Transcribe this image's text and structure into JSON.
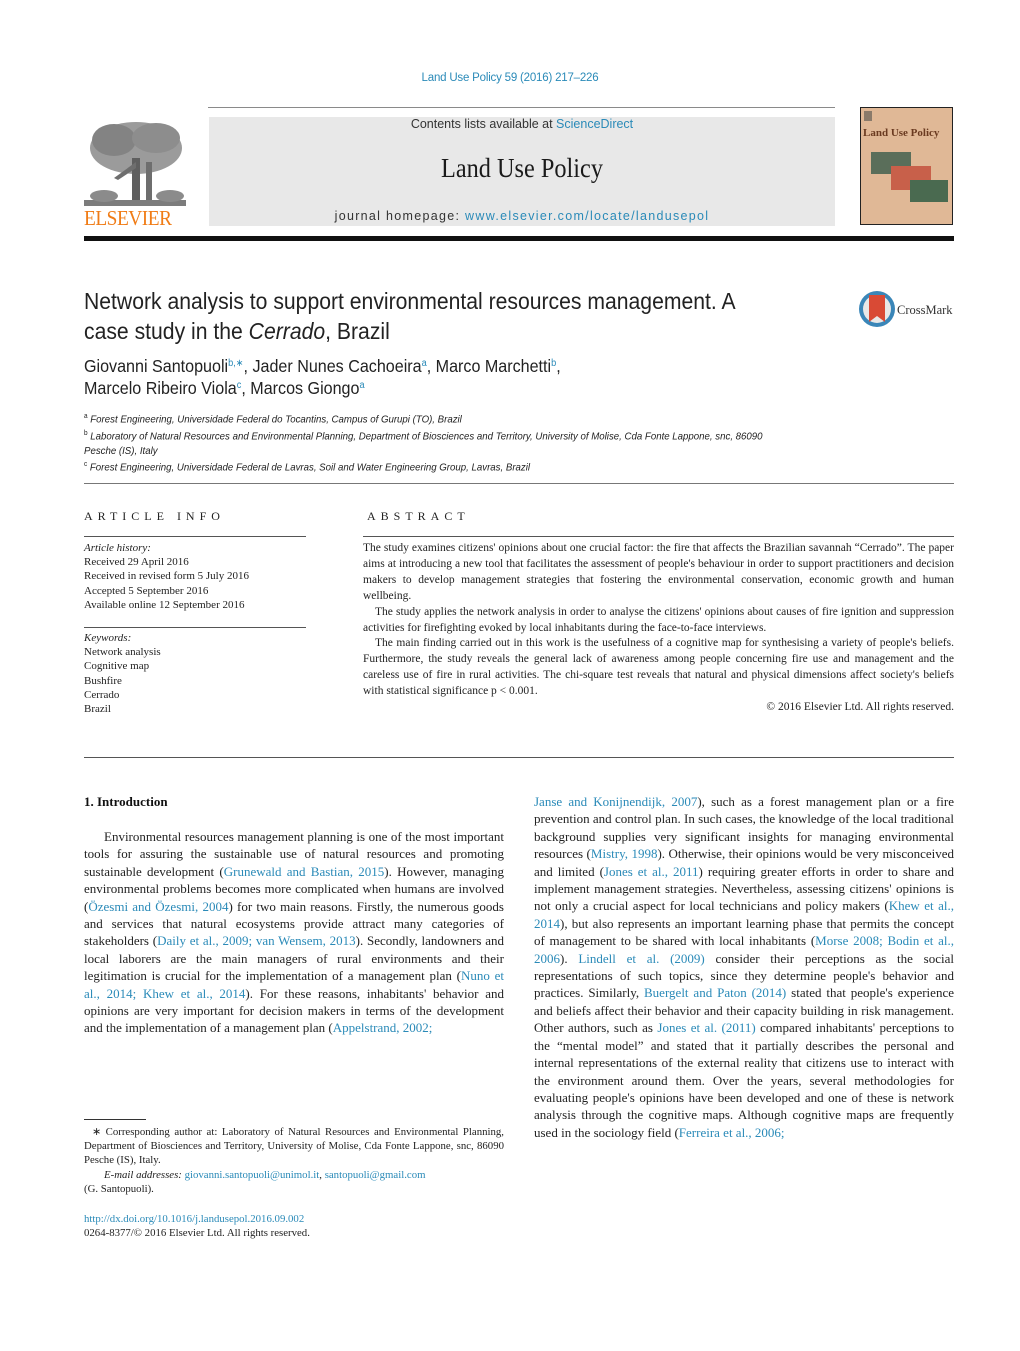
{
  "header": {
    "citation": "Land Use Policy 59 (2016) 217–226",
    "contents_prefix": "Contents lists available at ",
    "contents_link": "ScienceDirect",
    "journal_title": "Land Use Policy",
    "homepage_prefix": "journal homepage: ",
    "homepage_link": "www.elsevier.com/locate/landusepol",
    "publisher_logo_text": "ELSEVIER",
    "cover_title": "Land Use Policy",
    "colors": {
      "link": "#2a8ab8",
      "elsevier_orange": "#f07c16",
      "masthead_bg": "#e8e8e8",
      "cover_bg": "#e0b896"
    }
  },
  "article": {
    "title_line1": "Network analysis to support environmental resources management. A",
    "title_line2_prefix": "case study in the ",
    "title_line2_italic": "Cerrado",
    "title_line2_suffix": ", Brazil",
    "crossmark_label": "CrossMark",
    "authors": [
      {
        "name": "Giovanni Santopuoli",
        "sup": "b,∗",
        "sep": ", "
      },
      {
        "name": "Jader Nunes Cachoeira",
        "sup": "a",
        "sep": ", "
      },
      {
        "name": "Marco Marchetti",
        "sup": "b",
        "sep": ","
      },
      {
        "name": "Marcelo Ribeiro Viola",
        "sup": "c",
        "sep": ", "
      },
      {
        "name": "Marcos Giongo",
        "sup": "a",
        "sep": ""
      }
    ],
    "affiliations": [
      {
        "mark": "a",
        "text": "Forest Engineering, Universidade Federal do Tocantins, Campus of Gurupi (TO), Brazil"
      },
      {
        "mark": "b",
        "text": "Laboratory of Natural Resources and Environmental Planning, Department of Biosciences and Territory, University of Molise, Cda Fonte Lappone, snc, 86090 Pesche (IS), Italy"
      },
      {
        "mark": "c",
        "text": "Forest Engineering, Universidade Federal de Lavras, Soil and Water Engineering Group, Lavras, Brazil"
      }
    ]
  },
  "article_info": {
    "heading": "ARTICLE INFO",
    "history_label": "Article history:",
    "history": [
      "Received 29 April 2016",
      "Received in revised form 5 July 2016",
      "Accepted 5 September 2016",
      "Available online 12 September 2016"
    ],
    "keywords_label": "Keywords:",
    "keywords": [
      "Network analysis",
      "Cognitive map",
      "Bushfire",
      "Cerrado",
      "Brazil"
    ]
  },
  "abstract": {
    "heading": "ABSTRACT",
    "paragraphs": [
      "The study examines citizens' opinions about one crucial factor: the fire that affects the Brazilian savannah “Cerrado”. The paper aims at introducing a new tool that facilitates the assessment of people's behaviour in order to support practitioners and decision makers to develop management strategies that fostering the environmental conservation, economic growth and human wellbeing.",
      "The study applies the network analysis in order to analyse the citizens' opinions about causes of fire ignition and suppression activities for firefighting evoked by local inhabitants during the face-to-face interviews.",
      "The main finding carried out in this work is the usefulness of a cognitive map for synthesising a variety of people's beliefs. Furthermore, the study reveals the general lack of awareness among people concerning fire use and management and the careless use of fire in rural activities. The chi-square test reveals that natural and physical dimensions affect society's beliefs with statistical significance p < 0.001."
    ],
    "copyright": "© 2016 Elsevier Ltd. All rights reserved."
  },
  "body": {
    "section_heading": "1.  Introduction",
    "left_column": [
      {
        "t": "Environmental resources management planning is one of the most important tools for assuring the sustainable use of natural resources and promoting sustainable development ("
      },
      {
        "l": "Grunewald and Bastian, 2015"
      },
      {
        "t": "). However, managing environmental problems becomes more complicated when humans are involved ("
      },
      {
        "l": "Özesmi and Özesmi, 2004"
      },
      {
        "t": ") for two main reasons. Firstly, the numerous goods and services that natural ecosystems provide attract many categories of stakeholders ("
      },
      {
        "l": "Daily et al., 2009; van Wensem, 2013"
      },
      {
        "t": "). Secondly, landowners and local laborers are the main managers of rural environments and their legitimation is crucial for the implementation of a management plan ("
      },
      {
        "l": "Nuno et al., 2014; Khew et al., 2014"
      },
      {
        "t": "). For these reasons, inhabitants' behavior and opinions are very important for decision makers in terms of the development and the implementation of a management plan ("
      },
      {
        "l": "Appelstrand, 2002;"
      }
    ],
    "right_column": [
      {
        "l": "Janse and Konijnendijk, 2007"
      },
      {
        "t": "), such as a forest management plan or a fire prevention and control plan. In such cases, the knowledge of the local traditional background supplies very significant insights for managing environmental resources ("
      },
      {
        "l": "Mistry, 1998"
      },
      {
        "t": "). Otherwise, their opinions would be very misconceived and limited ("
      },
      {
        "l": "Jones et al., 2011"
      },
      {
        "t": ") requiring greater efforts in order to share and implement management strategies. Nevertheless, assessing citizens' opinions is not only a crucial aspect for local technicians and policy makers ("
      },
      {
        "l": "Khew et al., 2014"
      },
      {
        "t": "), but also represents an important learning phase that permits the concept of management to be shared with local inhabitants ("
      },
      {
        "l": "Morse 2008; Bodin et al., 2006"
      },
      {
        "t": "). "
      },
      {
        "l": "Lindell et al. (2009)"
      },
      {
        "t": " consider their perceptions as the social representations of such topics, since they determine people's behavior and practices. Similarly, "
      },
      {
        "l": "Buergelt and Paton (2014)"
      },
      {
        "t": " stated that people's experience and beliefs affect their behavior and their capacity building in risk management. Other authors, such as "
      },
      {
        "l": "Jones et al. (2011)"
      },
      {
        "t": " compared inhabitants' perceptions to the “mental model” and stated that it partially describes the personal and internal representations of the external reality that citizens use to interact with the environment around them. Over the years, several methodologies for evaluating people's opinions have been developed and one of these is network analysis through the cognitive maps. Although cognitive maps are frequently used in the sociology field ("
      },
      {
        "l": "Ferreira et al., 2006;"
      }
    ]
  },
  "footnote": {
    "corresponding": "∗  Corresponding author at: Laboratory of Natural Resources and Environmental Planning, Department of Biosciences and Territory, University of Molise, Cda Fonte Lappone, snc, 86090 Pesche (IS), Italy.",
    "email_label": "E-mail addresses: ",
    "email1": "giovanni.santopuoli@unimol.it",
    "email_sep": ", ",
    "email2": "santopuoli@gmail.com",
    "email_owner": "(G. Santopuoli).",
    "doi": "http://dx.doi.org/10.1016/j.landusepol.2016.09.002",
    "issn_copyright": "0264-8377/© 2016 Elsevier Ltd. All rights reserved."
  }
}
